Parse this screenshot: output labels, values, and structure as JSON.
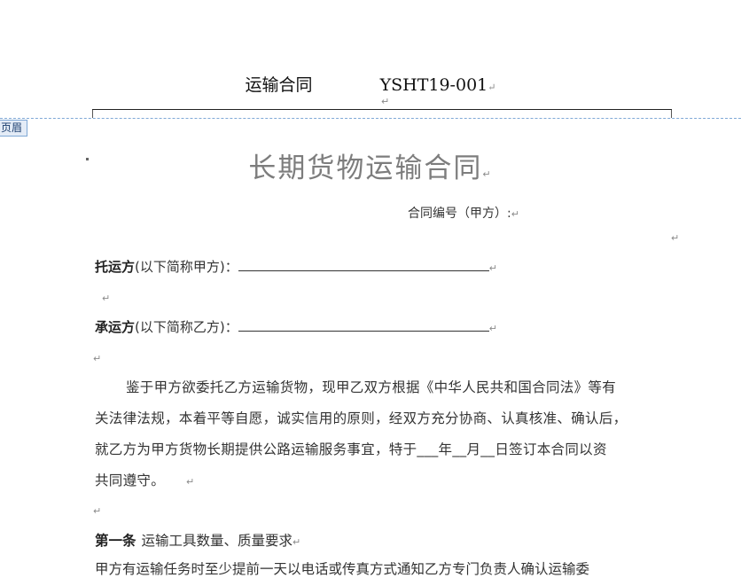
{
  "header": {
    "doc_name": "运输合同",
    "doc_code": "YSHT19-001",
    "tab_label": "页眉"
  },
  "title": "长期货物运输合同",
  "contract_no_label": "合同编号（甲方）:",
  "party_a": {
    "label": "托运方",
    "note": "(以下简称甲方)："
  },
  "party_b": {
    "label": "承运方",
    "note": "(以下简称乙方)："
  },
  "preamble": {
    "line1": "鉴于甲方欲委托乙方运输货物，现甲乙双方根据《中华人民共和国合同法》等有",
    "line2": "关法律法规，本着平等自愿，诚实信用的原则，经双方充分协商、认真核准、确认后，",
    "line3": "就乙方为甲方货物长期提供公路运输服务事宜，特于___年__月__日签订本合同以资",
    "line4": "共同遵守。"
  },
  "article1": {
    "number": "第一条",
    "title": "运输工具数量、质量要求"
  },
  "article1_text": "甲方有运输任务时至少提前一天以电话或传真方式通知乙方专门负责人确认运输委"
}
